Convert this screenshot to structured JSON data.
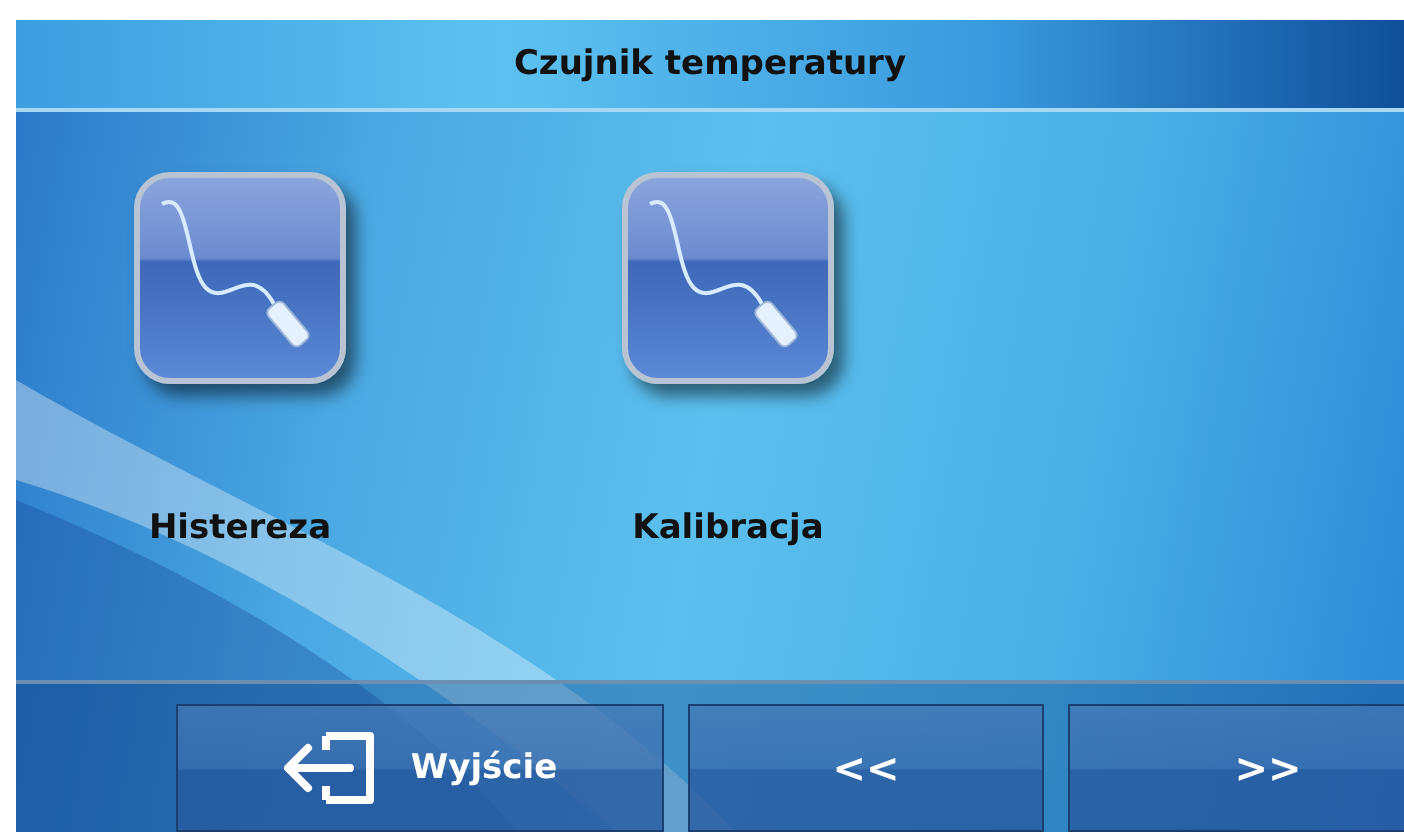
{
  "header": {
    "title": "Czujnik temperatury"
  },
  "tiles": [
    {
      "label": "Histereza"
    },
    {
      "label": "Kalibracja"
    }
  ],
  "buttons": [
    {
      "kind": "exit",
      "label": "Wyjście"
    },
    {
      "kind": "nav",
      "label": "<<"
    },
    {
      "kind": "nav",
      "label": ">>"
    }
  ]
}
